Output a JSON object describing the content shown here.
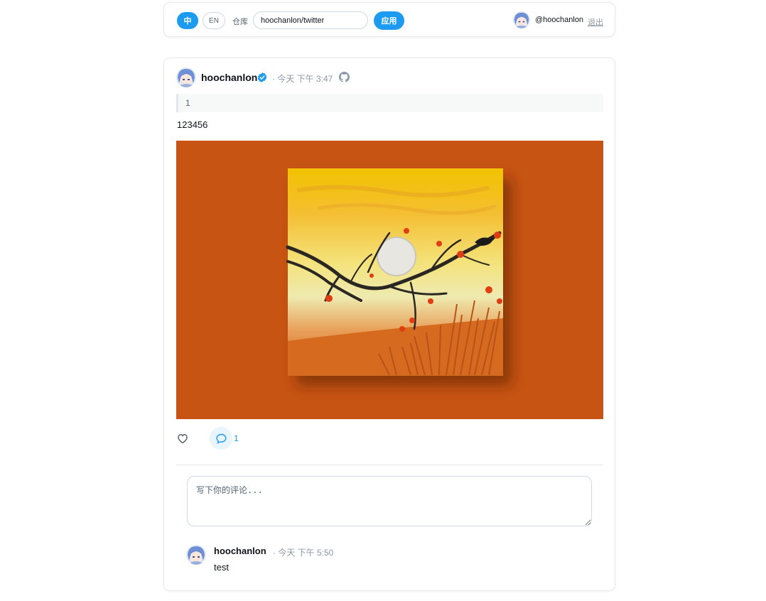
{
  "header": {
    "lang_zh": "中",
    "lang_en": "EN",
    "repo_label": "仓库",
    "repo_value": "hoochanlon/twitter",
    "apply_label": "应用",
    "user_handle": "@hoochanlon",
    "logout_label": "退出"
  },
  "tweet": {
    "author": "hoochanlon",
    "meta": "· 今天 下午 3:47",
    "quote": "1",
    "text": "123456",
    "reply_count": "1"
  },
  "comment_input": {
    "placeholder": "写下你的评论..."
  },
  "comments": [
    {
      "author": "hoochanlon",
      "meta": "· 今天 下午 5:50",
      "text": "test"
    }
  ],
  "colors": {
    "accent": "#1d9bf0",
    "media_bg": "#c75412"
  }
}
